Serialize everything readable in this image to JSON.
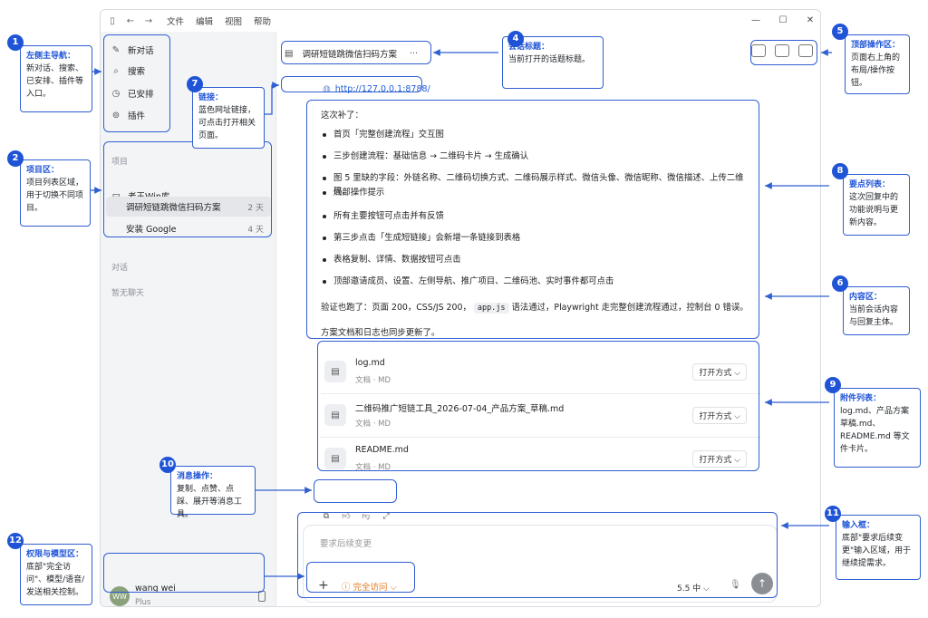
{
  "titlebar": {
    "menus": [
      "文件",
      "编辑",
      "视图",
      "帮助"
    ]
  },
  "sidebar": {
    "nav": [
      {
        "label": "新对话",
        "icon": "new-chat-icon"
      },
      {
        "label": "搜索",
        "icon": "search-icon"
      },
      {
        "label": "已安排",
        "icon": "clock-icon"
      },
      {
        "label": "插件",
        "icon": "plugin-icon"
      }
    ],
    "projects_label": "项目",
    "folder": "老王Win库",
    "chats": [
      {
        "title": "调研短链跳微信扫码方案",
        "age": "2 天"
      },
      {
        "title": "安装 Google",
        "age": "4 天"
      }
    ],
    "dialogs_label": "对话",
    "empty_label": "暂无聊天",
    "user": {
      "initials": "WW",
      "name": "wang wei",
      "plan": "Plus"
    }
  },
  "main": {
    "conversation_title": "调研短链跳微信扫码方案",
    "more": "···",
    "link": "http://127.0.0.1:8788/",
    "intro": "这次补了：",
    "bullets": [
      "首页「完整创建流程」交互图",
      "三步创建流程：基础信息 → 二维码卡片 → 生成确认",
      "图 5 里缺的字段：外链名称、二维码切换方式、二维码展示样式、微信头像、微信昵称、微信描述、上传二维码、",
      "底部操作提示",
      "所有主要按钮可点击并有反馈",
      "第三步点击「生成短链接」会新增一条链接到表格",
      "表格复制、详情、数据按钮可点击",
      "顶部邀请成员、设置、左侧导航、推广项目、二维码池、实时事件都可点击"
    ],
    "verify_pre": "验证也跑了：页面 200，CSS/JS 200，",
    "verify_code": "app.js",
    "verify_post": "语法通过，Playwright 走完整创建流程通过，控制台 0 错误。",
    "docs_note": "方案文档和日志也同步更新了。",
    "attachments": [
      {
        "name": "log.md",
        "type": "文档 · MD",
        "open": "打开方式 ⌵"
      },
      {
        "name": "二维码推广短链工具_2026-07-04_产品方案_草稿.md",
        "type": "文档 · MD",
        "open": "打开方式 ⌵"
      },
      {
        "name": "README.md",
        "type": "文档 · MD",
        "open": "打开方式 ⌵"
      }
    ],
    "input": {
      "placeholder": "要求后续变更",
      "access": "完全访问 ⌵",
      "model": "5.5 中 ⌵"
    }
  },
  "callouts": [
    {
      "n": "1",
      "title": "左侧主导航：",
      "body": "新对话、搜索、已安排、插件等入口。"
    },
    {
      "n": "2",
      "title": "项目区：",
      "body": "项目列表区域，用于切换不同项目。"
    },
    {
      "n": "4",
      "title": "会话标题：",
      "body": "当前打开的话题标题。"
    },
    {
      "n": "5",
      "title": "顶部操作区：",
      "body": "页面右上角的布局/操作按钮。"
    },
    {
      "n": "6",
      "title": "内容区：",
      "body": "当前会话内容与回复主体。"
    },
    {
      "n": "7",
      "title": "链接：",
      "body": "蓝色网址链接，可点击打开相关页面。"
    },
    {
      "n": "8",
      "title": "要点列表：",
      "body": "这次回复中的功能说明与更新内容。"
    },
    {
      "n": "9",
      "title": "附件列表：",
      "body": "log.md、产品方案草稿.md、README.md 等文件卡片。"
    },
    {
      "n": "10",
      "title": "消息操作：",
      "body": "复制、点赞、点踩、展开等消息工具。"
    },
    {
      "n": "11",
      "title": "输入框：",
      "body": "底部\"要求后续变更\"输入区域，用于继续提需求。"
    },
    {
      "n": "12",
      "title": "权限与模型区：",
      "body": "底部\"完全访问\"、模型/语音/发送相关控制。"
    }
  ],
  "colors": {
    "accent": "#1f54d6",
    "link": "#1f5bd6",
    "warning": "#e07a20"
  }
}
